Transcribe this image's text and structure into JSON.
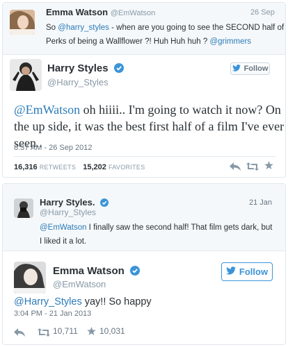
{
  "quoted_tweet": {
    "name": "Emma Watson",
    "handle": "@EmWatson",
    "date": "26 Sep",
    "line1_pre": "So ",
    "mention": "@harry_styles",
    "line1_post": " - when are you going to see the SECOND half of",
    "line2_text": "Perks of being a Wallflower ?! Huh Huh huh ? ",
    "line2_mention": "@grimmers"
  },
  "reply_tweet": {
    "name": "Harry Styles",
    "handle": "@Harry_Styles",
    "follow_label": "Follow",
    "mention": "@EmWatson",
    "line1_rest": " oh hiiii.. I'm going to watch it now? On",
    "line2": "the up side, it was the best first half of a film I've ever",
    "line3": "seen..",
    "timestamp": "8:37 AM - 26 Sep 2012",
    "retweets_count": "16,316",
    "retweets_label": "RETWEETS",
    "favorites_count": "15,202",
    "favorites_label": "FAVORITES",
    "icons": [
      "reply-icon",
      "retweet-icon",
      "favorite-icon"
    ]
  },
  "harry_tweet": {
    "name": "Harry Styles.",
    "handle": "@Harry_Styles",
    "date": "21 Jan",
    "mention": "@EmWatson",
    "line1_rest": " I finally saw the second half! That film gets dark, but",
    "line2": "I liked it a lot."
  },
  "emma_reply": {
    "name": "Emma Watson",
    "handle": "@EmWatson",
    "follow_label": "Follow",
    "mention": "@Harry_Styles",
    "text_rest": " yay!! So happy",
    "timestamp": "3:04 PM - 21 Jan 2013",
    "retweets_count": "10,711",
    "favorites_count": "10,031",
    "icons": [
      "reply-icon",
      "retweet-icon",
      "star-icon"
    ]
  },
  "colors": {
    "link": "#2b7bb9",
    "verified": "#3b94d9",
    "muted": "#8899a6",
    "border": "#e1e8ed"
  }
}
